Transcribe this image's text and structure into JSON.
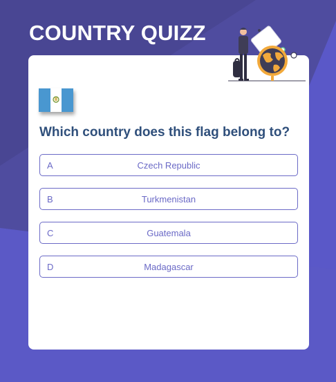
{
  "app": {
    "title": "COUNTRY QUIZZ"
  },
  "quiz": {
    "question": "Which country does this flag belong to?",
    "flag_icon": "guatemala-flag-icon",
    "options": [
      {
        "letter": "A",
        "label": "Czech Republic"
      },
      {
        "letter": "B",
        "label": "Turkmenistan"
      },
      {
        "letter": "C",
        "label": "Guatemala"
      },
      {
        "letter": "D",
        "label": "Madagascar"
      }
    ]
  },
  "colors": {
    "background": "#5a57c4",
    "card": "#ffffff",
    "accent": "#6a69c6",
    "question": "#2f4f7b",
    "illustration_orange": "#f2a93b"
  }
}
